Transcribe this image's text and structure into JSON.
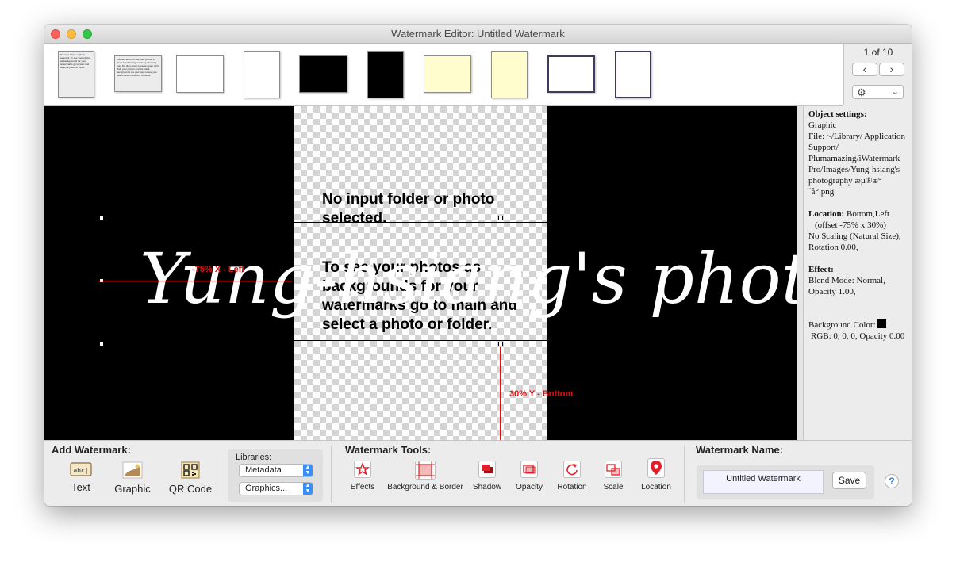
{
  "window": {
    "title": "Watermark Editor: Untitled Watermark"
  },
  "pager": {
    "count": "1 of 10",
    "prev": "‹",
    "next": "›",
    "gear": "⚙",
    "chevron": "⌄"
  },
  "thumbnails": [
    {
      "kind": "text-portrait",
      "text": "No input folder or photo selected. To see your photos as backgrounds for your watermarks go to main and select a photo or folder."
    },
    {
      "kind": "text-landscape",
      "text": "You can select to use your photos in these blank backgrounds by choosing from the drop down menu at upper right. Both your photos and the blank backgrounds are just ways to see your watermarks in different contexts."
    },
    {
      "kind": "white-landscape"
    },
    {
      "kind": "white-portrait"
    },
    {
      "kind": "black-landscape"
    },
    {
      "kind": "black-portrait"
    },
    {
      "kind": "cream-landscape"
    },
    {
      "kind": "cream-portrait"
    },
    {
      "kind": "framed-landscape"
    },
    {
      "kind": "framed-portrait"
    }
  ],
  "canvas": {
    "placeholder_line1": "No input folder or photo selected.",
    "placeholder_line2": "To see your photos as backgrounds for your watermarks go to main and select a photo or folder.",
    "watermark_text": "Yung-hsiang's photography",
    "guide_x_label": "-75% X - Left",
    "guide_y_label": "30% Y - Bottom"
  },
  "inspector": {
    "object_heading": "Object settings:",
    "object_type": "Graphic",
    "file": "File: ~/Library/ Application Support/ Plumamazing/iWatermark Pro/Images/Yung-hsiang's photography æµ®æ° ´å°.png",
    "location_heading": "Location:",
    "location_value": "Bottom,Left",
    "location_offset": "(offset -75% x 30%)",
    "scaling": "No Scaling (Natural Size),",
    "rotation": "Rotation 0.00,",
    "effect_heading": "Effect:",
    "blend": "Blend Mode: Normal, Opacity 1.00,",
    "background_label": "Background Color:",
    "background_rgb": "RGB: 0, 0, 0, Opacity 0.00",
    "background_color": "#000000"
  },
  "add_watermark": {
    "title": "Add Watermark:",
    "text_label": "Text",
    "text_icon": "abc|",
    "graphic_label": "Graphic",
    "qr_label": "QR Code"
  },
  "libraries": {
    "caption": "Libraries:",
    "metadata_value": "Metadata",
    "graphics_value": "Graphics..."
  },
  "tools": {
    "title": "Watermark Tools:",
    "effects": "Effects",
    "background_border": "Background & Border",
    "shadow": "Shadow",
    "opacity": "Opacity",
    "rotation": "Rotation",
    "scale": "Scale",
    "location": "Location"
  },
  "name_panel": {
    "title": "Watermark Name:",
    "value": "Untitled Watermark",
    "save": "Save",
    "help": "?"
  },
  "colors": {
    "accent": "#3a8ef6",
    "guide": "#e01010",
    "canvas": "#000000",
    "icon_red": "#e0202a"
  }
}
